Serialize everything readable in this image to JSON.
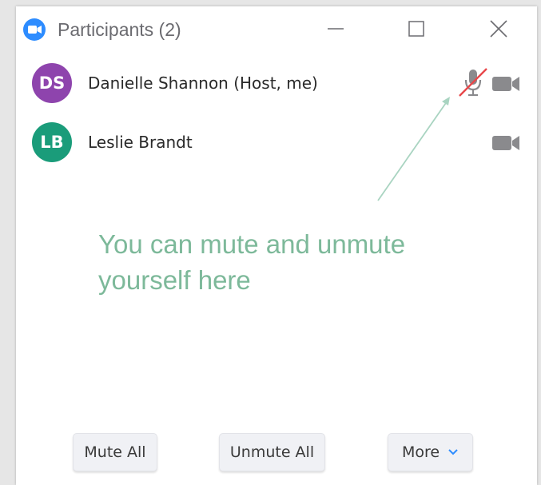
{
  "window": {
    "title": "Participants (2)"
  },
  "participants": [
    {
      "initials": "DS",
      "name": "Danielle Shannon (Host, me)",
      "avatar_color": "#8e44ad",
      "mic": "muted"
    },
    {
      "initials": "LB",
      "name": "Leslie Brandt",
      "avatar_color": "#1a9c7a",
      "mic": "none"
    }
  ],
  "annotation": {
    "line1": "You can mute and unmute",
    "line2": "yourself here",
    "color": "#7db99a"
  },
  "footer": {
    "mute_all_label": "Mute All",
    "unmute_all_label": "Unmute All",
    "more_label": "More"
  },
  "colors": {
    "zoom_blue": "#2d8cff",
    "muted_slash": "#e8474a",
    "icon_gray": "#8a8a8d"
  }
}
